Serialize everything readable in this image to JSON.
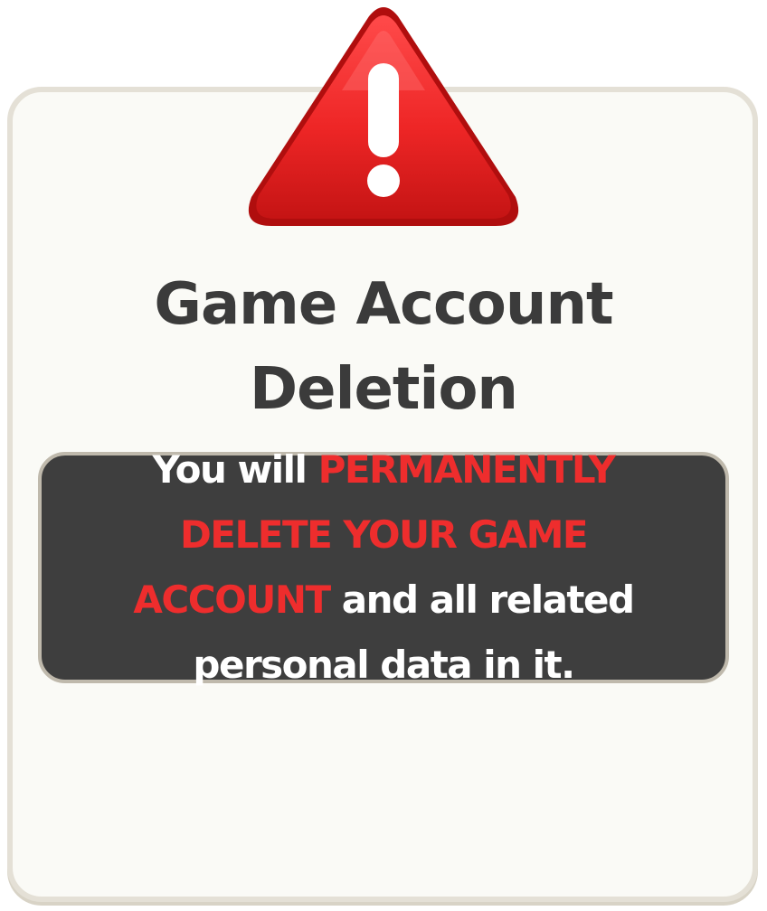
{
  "dialog": {
    "title": "Game Account Deletion",
    "message": {
      "prefix": "You will ",
      "highlight": "PERMANENTLY DELETE YOUR GAME ACCOUNT",
      "suffix": " and all related personal data in it."
    },
    "icon": "warning-triangle-icon"
  },
  "colors": {
    "card_background": "#fafaf6",
    "card_border": "#e4e0d6",
    "title_text": "#3b3b3b",
    "message_background": "#3e3e3e",
    "message_text": "#ffffff",
    "danger": "#ee2d2d"
  }
}
